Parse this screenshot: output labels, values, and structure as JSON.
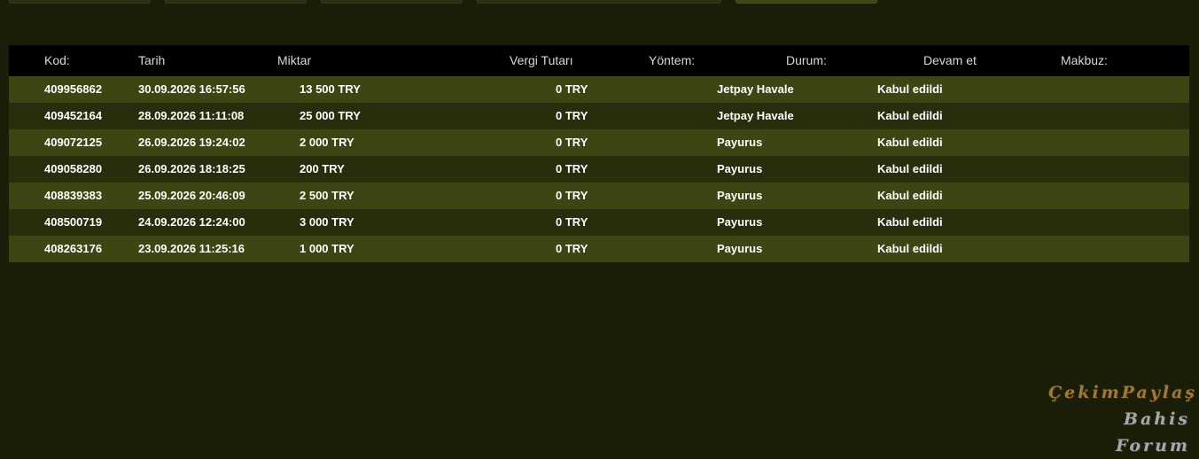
{
  "table": {
    "headers": [
      "Kod:",
      "Tarih",
      "Miktar",
      "Vergi Tutarı",
      "Yöntem:",
      "Durum:",
      "Devam et",
      "Makbuz:"
    ],
    "rows": [
      {
        "code": "409956862",
        "date": "30.09.2026 16:57:56",
        "amount": "13 500 TRY",
        "tax": "0 TRY",
        "method": "Jetpay Havale",
        "status": "Kabul edildi"
      },
      {
        "code": "409452164",
        "date": "28.09.2026 11:11:08",
        "amount": "25 000 TRY",
        "tax": "0 TRY",
        "method": "Jetpay Havale",
        "status": "Kabul edildi"
      },
      {
        "code": "409072125",
        "date": "26.09.2026 19:24:02",
        "amount": "2 000 TRY",
        "tax": "0 TRY",
        "method": "Payurus",
        "status": "Kabul edildi"
      },
      {
        "code": "409058280",
        "date": "26.09.2026 18:18:25",
        "amount": "200 TRY",
        "tax": "0 TRY",
        "method": "Payurus",
        "status": "Kabul edildi"
      },
      {
        "code": "408839383",
        "date": "25.09.2026 20:46:09",
        "amount": "2 500 TRY",
        "tax": "0 TRY",
        "method": "Payurus",
        "status": "Kabul edildi"
      },
      {
        "code": "408500719",
        "date": "24.09.2026 12:24:00",
        "amount": "3 000 TRY",
        "tax": "0 TRY",
        "method": "Payurus",
        "status": "Kabul edildi"
      },
      {
        "code": "408263176",
        "date": "23.09.2026 11:25:16",
        "amount": "1 000 TRY",
        "tax": "0 TRY",
        "method": "Payurus",
        "status": "Kabul edildi"
      }
    ]
  },
  "watermark": {
    "line1": "ÇekimPaylaş",
    "line2": "Bahis Forum"
  },
  "colors": {
    "background": "#1a1e09",
    "header_bg": "#000000",
    "row_odd": "#3b4613",
    "row_even": "#272e0c"
  }
}
